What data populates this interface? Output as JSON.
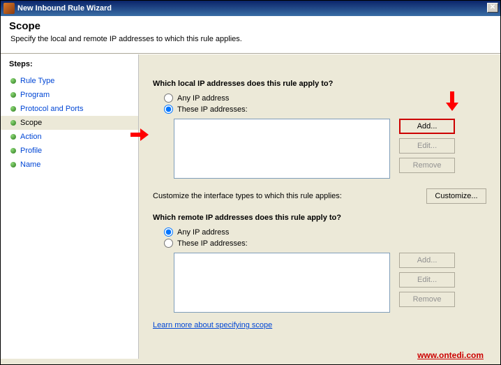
{
  "window": {
    "title": "New Inbound Rule Wizard",
    "close_glyph": "✕"
  },
  "header": {
    "title": "Scope",
    "subtitle": "Specify the local and remote IP addresses to which this rule applies."
  },
  "sidebar": {
    "heading": "Steps:",
    "items": [
      {
        "label": "Rule Type"
      },
      {
        "label": "Program"
      },
      {
        "label": "Protocol and Ports"
      },
      {
        "label": "Scope"
      },
      {
        "label": "Action"
      },
      {
        "label": "Profile"
      },
      {
        "label": "Name"
      }
    ],
    "active_index": 3
  },
  "main": {
    "local_question": "Which local IP addresses does this rule apply to?",
    "any_ip_label": "Any IP address",
    "these_ip_label": "These IP addresses:",
    "local_selected": "these",
    "customize_text": "Customize the interface types to which this rule applies:",
    "customize_btn": "Customize...",
    "remote_question": "Which remote IP addresses does this rule apply to?",
    "remote_selected": "any",
    "add_btn": "Add...",
    "edit_btn": "Edit...",
    "remove_btn": "Remove",
    "learn_link": "Learn more about specifying scope"
  },
  "watermark": "www.ontedi.com"
}
